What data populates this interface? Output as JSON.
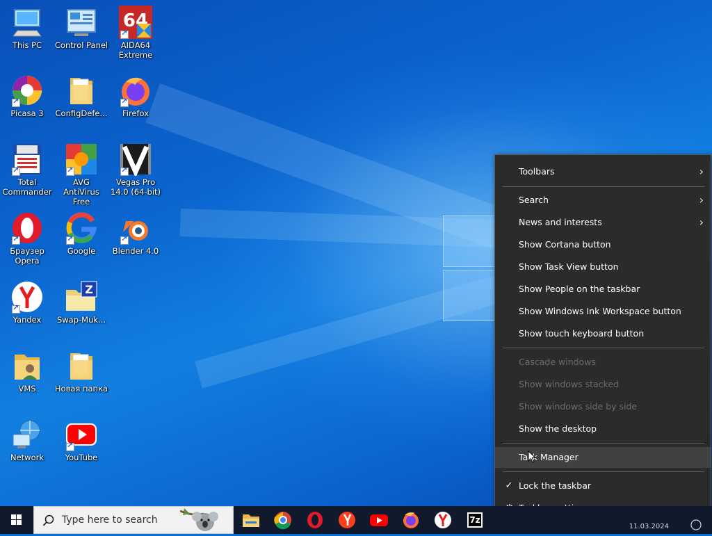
{
  "desktop": {
    "icons": [
      {
        "label": "This PC",
        "icon": "this-pc-icon"
      },
      {
        "label": "Control Panel",
        "icon": "control-panel-icon"
      },
      {
        "label": "AIDA64 Extreme",
        "icon": "aida64-icon"
      },
      {
        "label": "Picasa 3",
        "icon": "picasa-icon"
      },
      {
        "label": "ConfigDefe...",
        "icon": "folder-icon"
      },
      {
        "label": "Firefox",
        "icon": "firefox-icon"
      },
      {
        "label": "Total Commander",
        "icon": "total-commander-icon"
      },
      {
        "label": "AVG AntiVirus Free",
        "icon": "avg-icon"
      },
      {
        "label": "Vegas Pro 14.0 (64-bit)",
        "icon": "vegas-icon"
      },
      {
        "label": "Браузер Opera",
        "icon": "opera-icon"
      },
      {
        "label": "Google",
        "icon": "google-icon"
      },
      {
        "label": "Blender 4.0",
        "icon": "blender-icon"
      },
      {
        "label": "Yandex",
        "icon": "yandex-icon"
      },
      {
        "label": "Swap-Muk...",
        "icon": "zip-folder-icon"
      },
      {
        "label": "VMS",
        "icon": "user-folder-icon"
      },
      {
        "label": "Новая папка",
        "icon": "folder-icon"
      },
      {
        "label": "Network",
        "icon": "network-icon"
      },
      {
        "label": "YouTube",
        "icon": "youtube-icon"
      }
    ]
  },
  "context_menu": {
    "toolbars": "Toolbars",
    "search": "Search",
    "news": "News and interests",
    "cortana": "Show Cortana button",
    "task_view": "Show Task View button",
    "people": "Show People on the taskbar",
    "ink": "Show Windows Ink Workspace button",
    "touch_keyboard": "Show touch keyboard button",
    "cascade": "Cascade windows",
    "stacked": "Show windows stacked",
    "side_by_side": "Show windows side by side",
    "show_desktop": "Show the desktop",
    "task_manager": "Task Manager",
    "lock_taskbar": "Lock the taskbar",
    "taskbar_settings": "Taskbar settings",
    "checkmark": "✓",
    "submenu_arrow": "›"
  },
  "taskbar": {
    "search_placeholder": "Type here to search",
    "clock_date": "11.03.2024",
    "pinned": [
      "file-explorer-icon",
      "chrome-icon",
      "opera-icon",
      "yandex-browser-icon",
      "youtube-icon",
      "firefox-icon",
      "yandex-icon",
      "7zip-icon"
    ],
    "seven_zip_label": "7z"
  },
  "colors": {
    "menu_bg": "#2b2b2b",
    "menu_hover": "#414141",
    "menu_disabled": "#6d6d6d",
    "taskbar_bg": "#101a2c",
    "desktop_blue": "#0b66d0"
  }
}
